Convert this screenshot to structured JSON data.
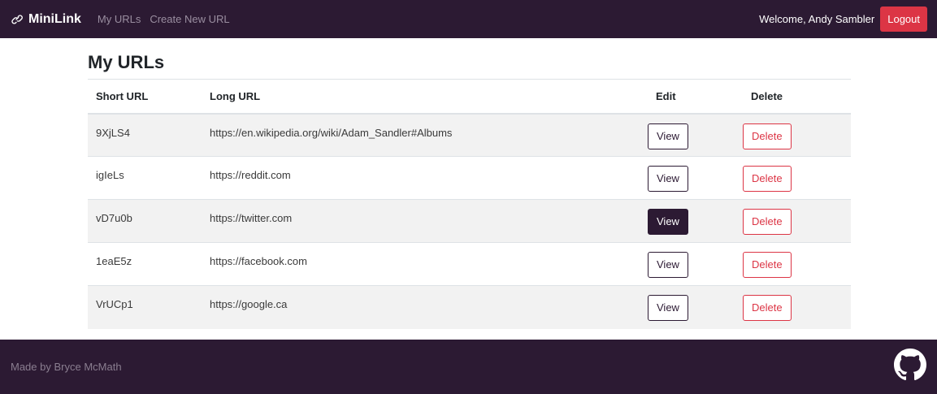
{
  "nav": {
    "brand": "MiniLink",
    "links": [
      "My URLs",
      "Create New URL"
    ],
    "welcome": "Welcome, Andy Sambler",
    "logout": "Logout"
  },
  "main": {
    "title": "My URLs",
    "headers": [
      "Short URL",
      "Long URL",
      "Edit",
      "Delete"
    ],
    "view_label": "View",
    "delete_label": "Delete",
    "rows": [
      {
        "short": "9XjLS4",
        "long": "https://en.wikipedia.org/wiki/Adam_Sandler#Albums"
      },
      {
        "short": "igIeLs",
        "long": "https://reddit.com"
      },
      {
        "short": "vD7u0b",
        "long": "https://twitter.com"
      },
      {
        "short": "1eaE5z",
        "long": "https://facebook.com"
      },
      {
        "short": "VrUCp1",
        "long": "https://google.ca"
      }
    ]
  },
  "footer": {
    "credit": "Made by Bryce McMath",
    "icon": "github-icon"
  },
  "colors": {
    "primary": "#2c1a33",
    "danger": "#dc3545"
  }
}
